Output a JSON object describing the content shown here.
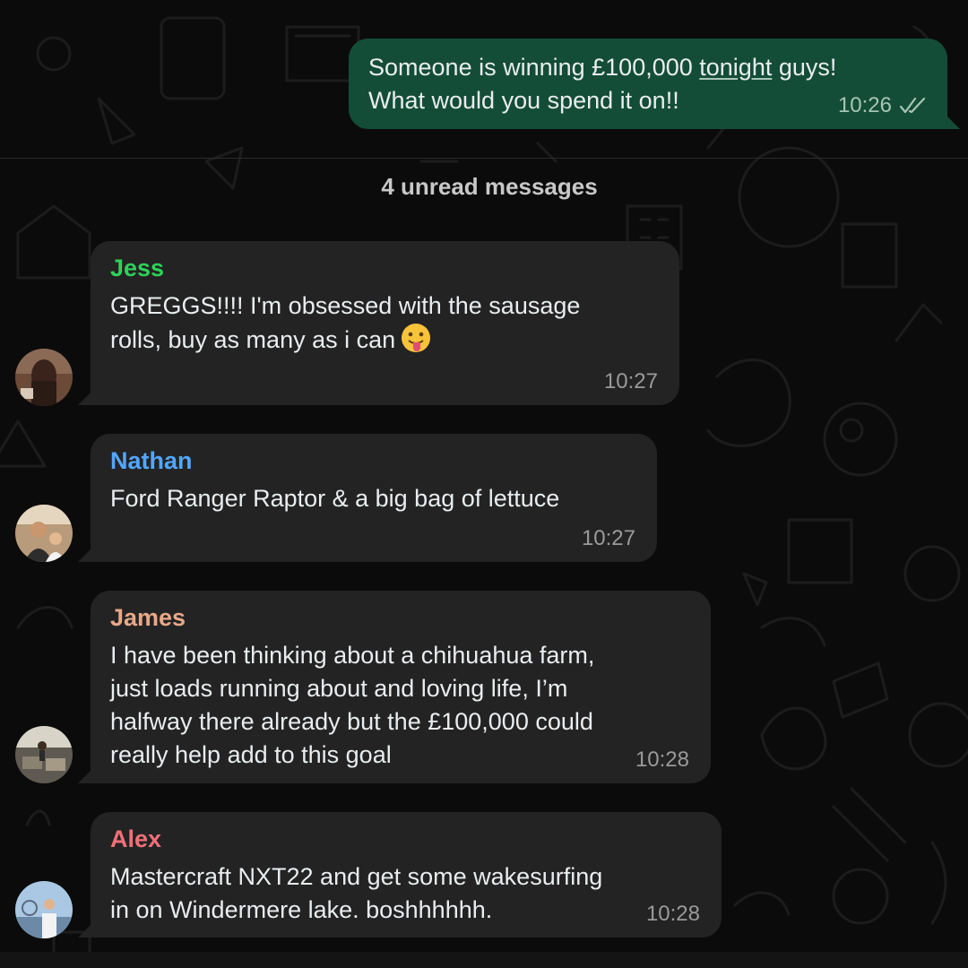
{
  "outgoing": {
    "text_before": "Someone is winning £100,000 ",
    "link_word": "tonight",
    "text_after": " guys!\nWhat would you spend it on!!",
    "time": "10:26",
    "status_icon": "double-check-icon"
  },
  "divider": {
    "label": "4 unread messages"
  },
  "messages": [
    {
      "sender": "Jess",
      "sender_color": "#2fd15a",
      "text": "GREGGS!!!! I'm obsessed with the sausage\nrolls, buy as many as i can",
      "emoji": "tongue-out-face-icon",
      "time": "10:27"
    },
    {
      "sender": "Nathan",
      "sender_color": "#53a6ff",
      "text": "Ford Ranger Raptor & a big bag of lettuce",
      "time": "10:27"
    },
    {
      "sender": "James",
      "sender_color": "#e8a889",
      "text": "I have been thinking about a chihuahua farm,\njust loads running about and loving life, I’m\nhalfway there already but the £100,000 could\nreally help add to this goal",
      "time": "10:28"
    },
    {
      "sender": "Alex",
      "sender_color": "#f0707a",
      "text": "Mastercraft NXT22 and get some wakesurfing\nin on Windermere lake. boshhhhhh.",
      "time": "10:28"
    }
  ],
  "colors": {
    "background": "#0b0b0b",
    "outgoing_bubble": "#144d37",
    "incoming_bubble": "#232323",
    "timestamp": "#9a9a9a"
  }
}
